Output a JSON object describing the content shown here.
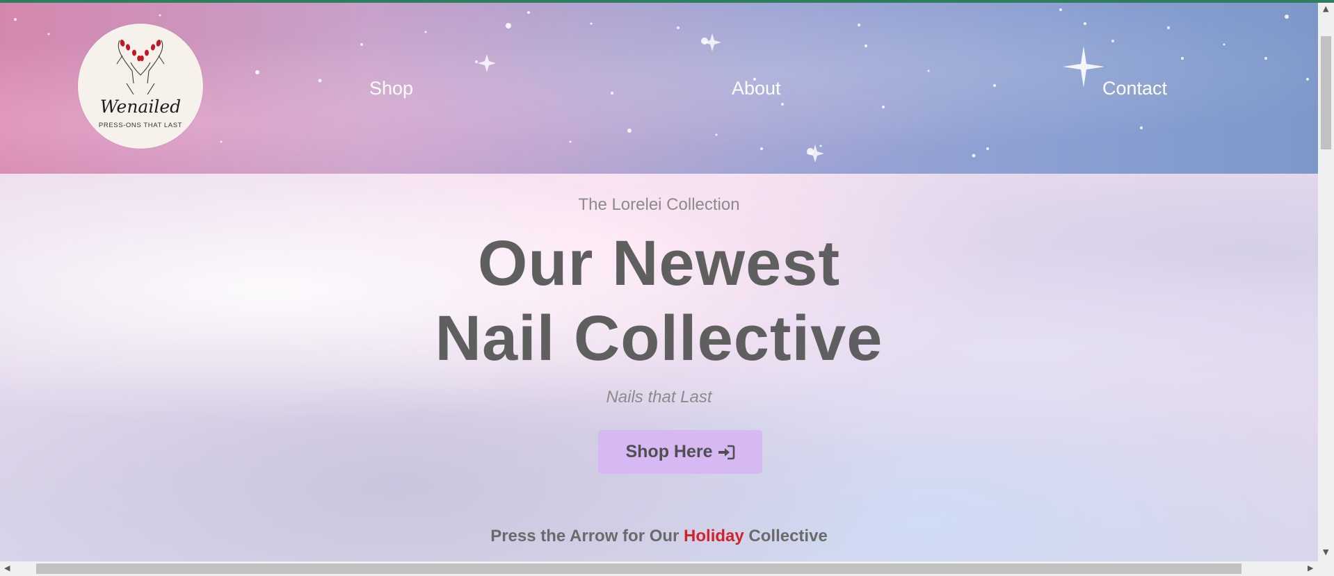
{
  "brand": {
    "name": "Wenailed",
    "tagline": "PRESS-ONS THAT LAST",
    "accent_color": "#d6b8f2",
    "highlight_color": "#d4212a"
  },
  "nav": {
    "shop": "Shop",
    "about": "About",
    "contact": "Contact"
  },
  "hero": {
    "subtitle": "The Lorelei Collection",
    "headline_line1": "Our Newest",
    "headline_line2": "Nail Collective",
    "tagline": "Nails that Last",
    "cta_label": "Shop Here",
    "cta_icon": "sign-in-icon",
    "promo_before": "Press the Arrow for Our",
    "promo_highlight": "Holiday",
    "promo_after": "Collective"
  }
}
